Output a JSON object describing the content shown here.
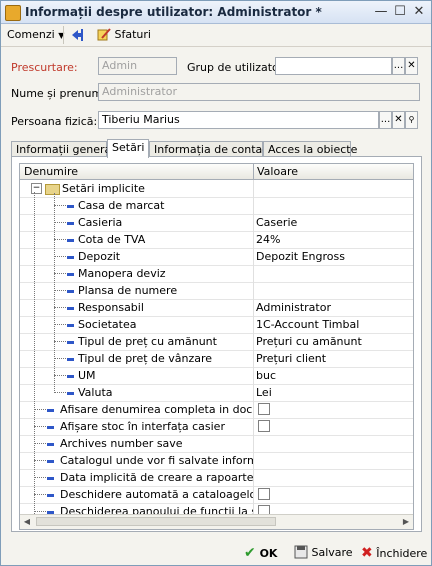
{
  "window": {
    "title": "Informații despre utilizator: Administrator *",
    "min_glyph": "—",
    "max_glyph": "☐",
    "close_glyph": "✕"
  },
  "toolbar": {
    "commands_label": "Comenzi",
    "hints_label": "Sfaturi"
  },
  "form": {
    "prescurtare_label": "Prescurtare:",
    "prescurtare_value": "Admin",
    "grup_label": "Grup de utilizatori:",
    "grup_value": "",
    "nume_label": "Nume și prenume:",
    "nume_value": "Administrator",
    "persoana_label": "Persoana fizică:",
    "persoana_value": "Tiberiu Marius",
    "select_glyph": "...",
    "clear_glyph": "✕",
    "search_glyph": "🔍"
  },
  "tabs": [
    {
      "label": "Informații generale"
    },
    {
      "label": "Setări"
    },
    {
      "label": "Informația de contact"
    },
    {
      "label": "Acces la obiecte"
    }
  ],
  "grid": {
    "col_name": "Denumire",
    "col_value": "Valoare",
    "group_label": "Setări implicite",
    "group_toggle": "−",
    "scroll_left": "◀",
    "scroll_right": "▶",
    "children": [
      {
        "name": "Casa de marcat",
        "value": ""
      },
      {
        "name": "Casieria",
        "value": "Caserie"
      },
      {
        "name": "Cota de TVA",
        "value": "24%"
      },
      {
        "name": "Depozit",
        "value": "Depozit Engross"
      },
      {
        "name": "Manopera deviz",
        "value": ""
      },
      {
        "name": "Plansa de numere",
        "value": ""
      },
      {
        "name": "Responsabil",
        "value": "Administrator"
      },
      {
        "name": "Societatea",
        "value": "1C-Account Timbal"
      },
      {
        "name": "Tipul de preț cu amănunt",
        "value": "Prețuri cu amănunt"
      },
      {
        "name": "Tipul de preț de vânzare",
        "value": "Prețuri client"
      },
      {
        "name": "UM",
        "value": "buc"
      },
      {
        "name": "Valuta",
        "value": "Lei"
      }
    ],
    "top_items": [
      {
        "name": "Afisare denumirea completa in docum...",
        "checkbox": true
      },
      {
        "name": "Afișare stoc în interfața casier",
        "checkbox": true
      },
      {
        "name": "Archives number save",
        "checkbox": false
      },
      {
        "name": "Catalogul unde vor fi salvate informațiil...",
        "checkbox": false
      },
      {
        "name": "Data implicită de creare a rapoartelor",
        "checkbox": false
      },
      {
        "name": "Deschidere automată a cataloagelor l...",
        "checkbox": true
      },
      {
        "name": "Deschiderea panoului de funcții la star...",
        "checkbox": true
      }
    ]
  },
  "buttons": {
    "ok_label": "OK",
    "save_label": "Salvare",
    "close_label": "Închidere"
  },
  "colors": {
    "accent": "#2e57c8",
    "required_label": "#c0392b",
    "ok_icon": "#2e9b2e",
    "close_icon": "#d02020"
  }
}
